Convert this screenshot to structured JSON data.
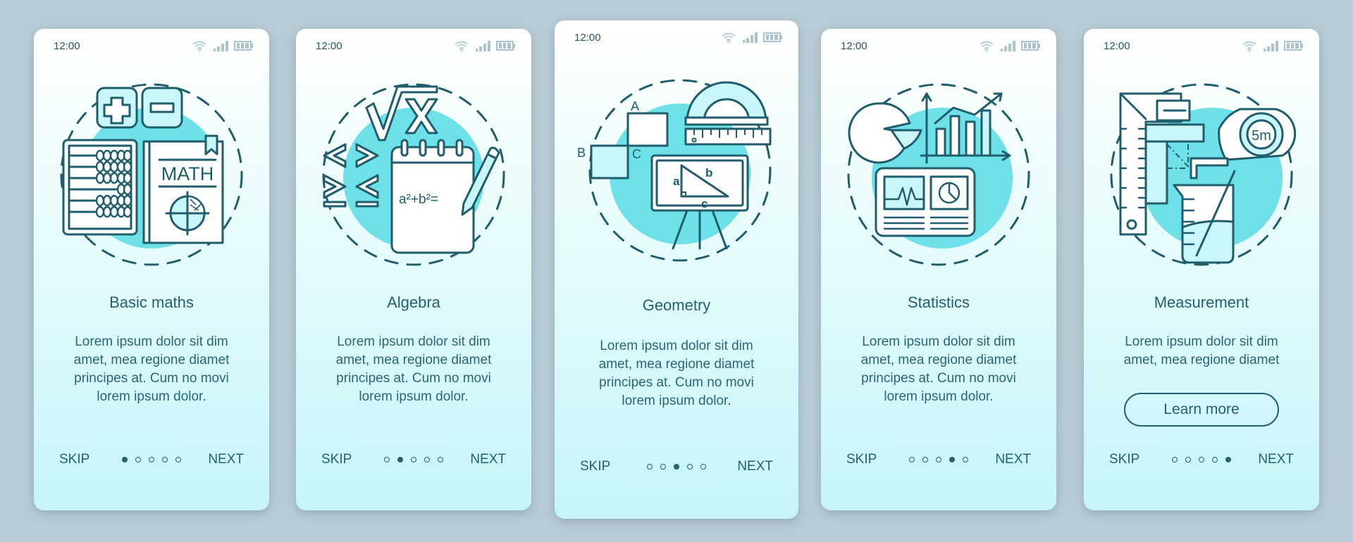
{
  "colors": {
    "page_background": "#b9ccd6",
    "accent_text": "#24606f",
    "illustration_fill": "#6de1e7",
    "stroke": "#1f5d6d"
  },
  "status_bar": {
    "time": "12:00",
    "icons": [
      "wifi-icon",
      "signal-icon",
      "battery-icon"
    ]
  },
  "screens": [
    {
      "title": "Basic maths",
      "illustration": "basic-maths-illustration",
      "body_lines": [
        "Lorem ipsum dolor sit dim",
        "amet, mea regione diamet",
        "principes at. Cum no movi",
        "lorem ipsum dolor."
      ],
      "active_dot": 0
    },
    {
      "title": "Algebra",
      "illustration": "algebra-illustration",
      "illustration_text": "a²+b²=",
      "body_lines": [
        "Lorem ipsum dolor sit dim",
        "amet, mea regione diamet",
        "principes at. Cum no movi",
        "lorem ipsum dolor."
      ],
      "active_dot": 1
    },
    {
      "title": "Geometry",
      "illustration": "geometry-illustration",
      "illustration_labels": [
        "A",
        "B",
        "C",
        "a",
        "b",
        "c"
      ],
      "body_lines": [
        "Lorem ipsum dolor sit dim",
        "amet, mea regione diamet",
        "principes at. Cum no movi",
        "lorem ipsum dolor."
      ],
      "active_dot": 2
    },
    {
      "title": "Statistics",
      "illustration": "statistics-illustration",
      "body_lines": [
        "Lorem ipsum dolor sit dim",
        "amet, mea regione diamet",
        "principes at. Cum no movi",
        "lorem ipsum dolor."
      ],
      "active_dot": 3
    },
    {
      "title": "Measurement",
      "illustration": "measurement-illustration",
      "illustration_text": "5m",
      "body_lines": [
        "Lorem ipsum dolor sit dim",
        "amet, mea regione diamet"
      ],
      "button_label": "Learn more",
      "active_dot": 4
    }
  ],
  "math_book_label": "MATH",
  "footer": {
    "skip_label": "SKIP",
    "next_label": "NEXT",
    "page_count": 5
  }
}
